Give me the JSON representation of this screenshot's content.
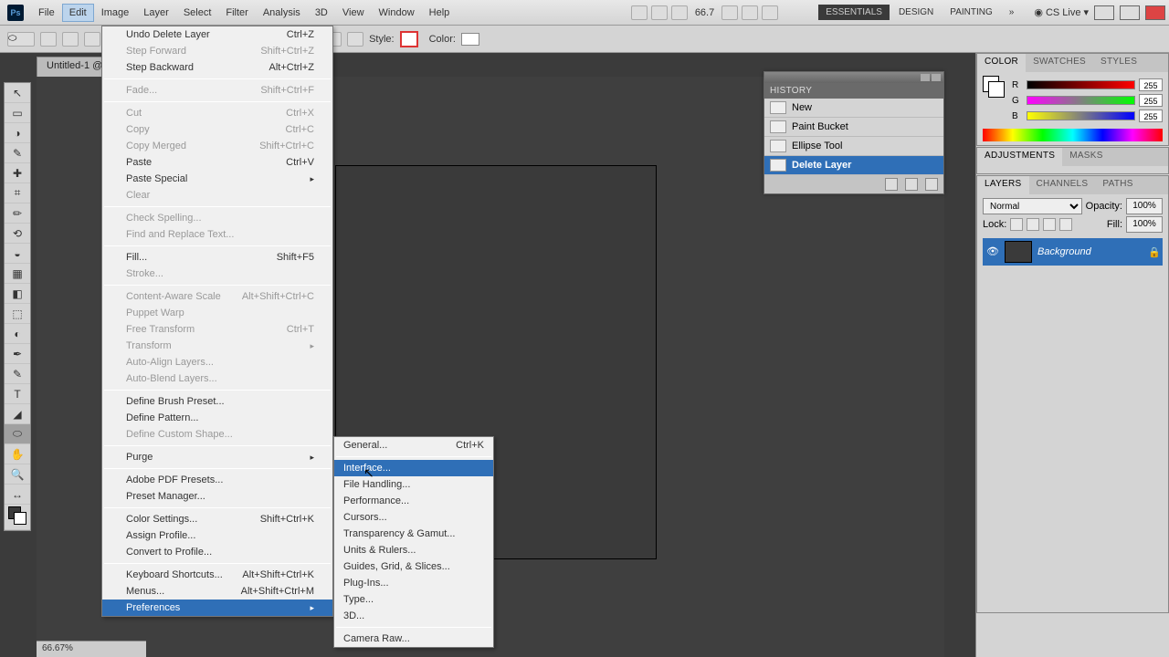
{
  "app_icon_text": "Ps",
  "menubar": [
    "File",
    "Edit",
    "Image",
    "Layer",
    "Select",
    "Filter",
    "Analysis",
    "3D",
    "View",
    "Window",
    "Help"
  ],
  "menubar_active_index": 1,
  "zoom_text": "66.7",
  "workspaces": [
    "ESSENTIALS",
    "DESIGN",
    "PAINTING"
  ],
  "cs_live": "CS Live",
  "optionsbar": {
    "style_label": "Style:",
    "color_label": "Color:"
  },
  "doc_tab": "Untitled-1 @",
  "status": "66.67%",
  "edit_menu": [
    {
      "label": "Undo Delete Layer",
      "shortcut": "Ctrl+Z"
    },
    {
      "label": "Step Forward",
      "shortcut": "Shift+Ctrl+Z",
      "disabled": true
    },
    {
      "label": "Step Backward",
      "shortcut": "Alt+Ctrl+Z"
    },
    {
      "sep": true
    },
    {
      "label": "Fade...",
      "shortcut": "Shift+Ctrl+F",
      "disabled": true
    },
    {
      "sep": true
    },
    {
      "label": "Cut",
      "shortcut": "Ctrl+X",
      "disabled": true
    },
    {
      "label": "Copy",
      "shortcut": "Ctrl+C",
      "disabled": true
    },
    {
      "label": "Copy Merged",
      "shortcut": "Shift+Ctrl+C",
      "disabled": true
    },
    {
      "label": "Paste",
      "shortcut": "Ctrl+V"
    },
    {
      "label": "Paste Special",
      "submenu": true
    },
    {
      "label": "Clear",
      "disabled": true
    },
    {
      "sep": true
    },
    {
      "label": "Check Spelling...",
      "disabled": true
    },
    {
      "label": "Find and Replace Text...",
      "disabled": true
    },
    {
      "sep": true
    },
    {
      "label": "Fill...",
      "shortcut": "Shift+F5"
    },
    {
      "label": "Stroke...",
      "disabled": true
    },
    {
      "sep": true
    },
    {
      "label": "Content-Aware Scale",
      "shortcut": "Alt+Shift+Ctrl+C",
      "disabled": true
    },
    {
      "label": "Puppet Warp",
      "disabled": true
    },
    {
      "label": "Free Transform",
      "shortcut": "Ctrl+T",
      "disabled": true
    },
    {
      "label": "Transform",
      "submenu": true,
      "disabled": true
    },
    {
      "label": "Auto-Align Layers...",
      "disabled": true
    },
    {
      "label": "Auto-Blend Layers...",
      "disabled": true
    },
    {
      "sep": true
    },
    {
      "label": "Define Brush Preset..."
    },
    {
      "label": "Define Pattern..."
    },
    {
      "label": "Define Custom Shape...",
      "disabled": true
    },
    {
      "sep": true
    },
    {
      "label": "Purge",
      "submenu": true
    },
    {
      "sep": true
    },
    {
      "label": "Adobe PDF Presets..."
    },
    {
      "label": "Preset Manager..."
    },
    {
      "sep": true
    },
    {
      "label": "Color Settings...",
      "shortcut": "Shift+Ctrl+K"
    },
    {
      "label": "Assign Profile..."
    },
    {
      "label": "Convert to Profile..."
    },
    {
      "sep": true
    },
    {
      "label": "Keyboard Shortcuts...",
      "shortcut": "Alt+Shift+Ctrl+K"
    },
    {
      "label": "Menus...",
      "shortcut": "Alt+Shift+Ctrl+M"
    },
    {
      "label": "Preferences",
      "submenu": true,
      "highlight": true
    }
  ],
  "prefs_submenu": [
    {
      "label": "General...",
      "shortcut": "Ctrl+K"
    },
    {
      "sep": true
    },
    {
      "label": "Interface...",
      "highlight": true
    },
    {
      "label": "File Handling..."
    },
    {
      "label": "Performance..."
    },
    {
      "label": "Cursors..."
    },
    {
      "label": "Transparency & Gamut..."
    },
    {
      "label": "Units & Rulers..."
    },
    {
      "label": "Guides, Grid, & Slices..."
    },
    {
      "label": "Plug-Ins..."
    },
    {
      "label": "Type..."
    },
    {
      "label": "3D..."
    },
    {
      "sep": true
    },
    {
      "label": "Camera Raw..."
    }
  ],
  "history": {
    "title": "HISTORY",
    "items": [
      "New",
      "Paint Bucket",
      "Ellipse Tool",
      "Delete Layer"
    ],
    "active_index": 3
  },
  "color_panel": {
    "tabs": [
      "COLOR",
      "SWATCHES",
      "STYLES"
    ],
    "r": "255",
    "g": "255",
    "b": "255"
  },
  "adjustments_panel": {
    "tabs": [
      "ADJUSTMENTS",
      "MASKS"
    ]
  },
  "layers_panel": {
    "tabs": [
      "LAYERS",
      "CHANNELS",
      "PATHS"
    ],
    "blend": "Normal",
    "opacity_label": "Opacity:",
    "opacity": "100%",
    "lock_label": "Lock:",
    "fill_label": "Fill:",
    "fill": "100%",
    "layer_name": "Background"
  },
  "tools": [
    "↖",
    "▭",
    "◑",
    "✎",
    "✚",
    "⌗",
    "✏",
    "⟲",
    "◒",
    "▦",
    "◧",
    "⬚",
    "◐",
    "✒",
    "✎",
    "T",
    "◢",
    "⬭",
    "✋",
    "🔍",
    "↔"
  ]
}
